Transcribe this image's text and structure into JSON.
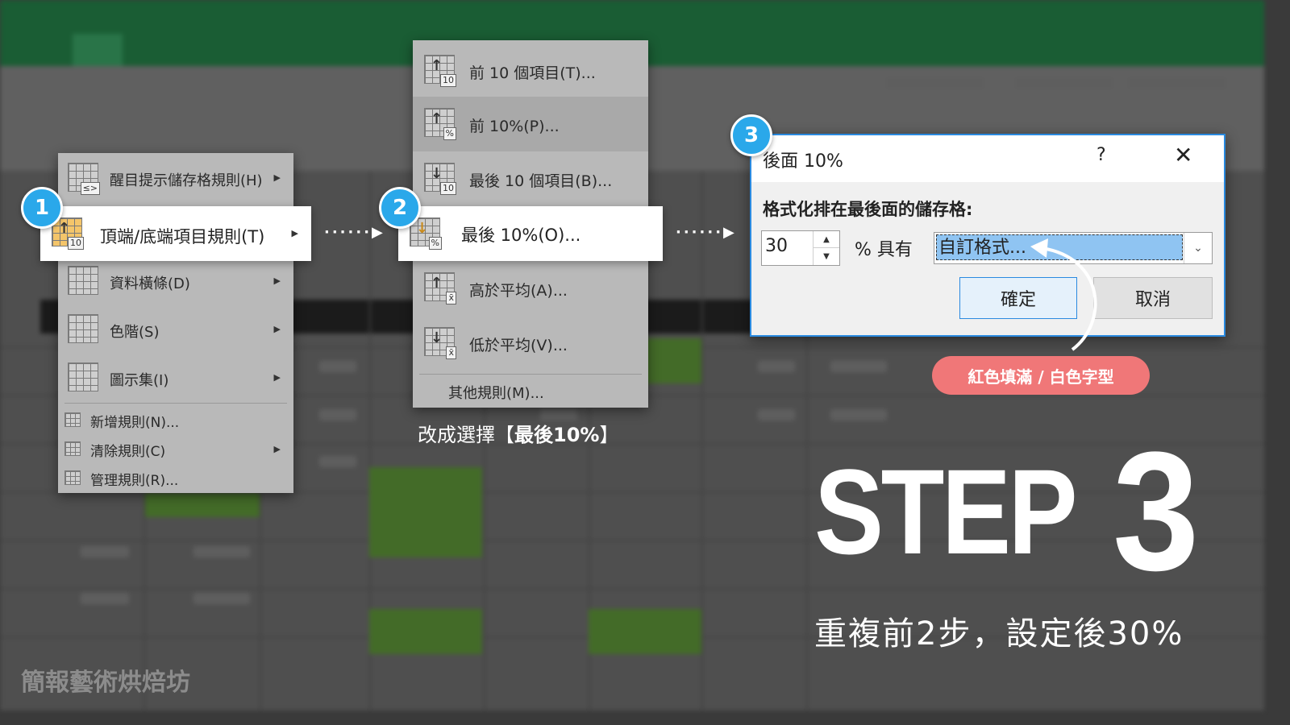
{
  "menu1": {
    "items": [
      {
        "label": "醒目提示儲存格規則(H)",
        "has_submenu": true,
        "icon": "highlight-cells-icon",
        "badge": "≤>"
      },
      {
        "label": "頂端/底端項目規則(T)",
        "has_submenu": true,
        "icon": "top-bottom-rules-icon",
        "badge": "10",
        "highlighted": true
      },
      {
        "label": "資料橫條(D)",
        "has_submenu": true,
        "icon": "data-bars-icon"
      },
      {
        "label": "色階(S)",
        "has_submenu": true,
        "icon": "color-scales-icon"
      },
      {
        "label": "圖示集(I)",
        "has_submenu": true,
        "icon": "icon-sets-icon"
      }
    ],
    "small_items": [
      {
        "label": "新增規則(N)...",
        "icon": "new-rule-icon"
      },
      {
        "label": "清除規則(C)",
        "icon": "clear-rules-icon",
        "has_submenu": true
      },
      {
        "label": "管理規則(R)...",
        "icon": "manage-rules-icon"
      }
    ]
  },
  "menu2": {
    "items": [
      {
        "label": "前 10 個項目(T)...",
        "icon": "top-10-icon",
        "badge": "10"
      },
      {
        "label": "前 10%(P)...",
        "icon": "top-10-percent-icon",
        "badge": "%"
      },
      {
        "label": "最後 10 個項目(B)...",
        "icon": "bottom-10-icon",
        "badge": "10"
      },
      {
        "label": "最後 10%(O)...",
        "icon": "bottom-10-percent-icon",
        "badge": "%",
        "highlighted": true
      },
      {
        "label": "高於平均(A)...",
        "icon": "above-average-icon",
        "badge": "x̄"
      },
      {
        "label": "低於平均(V)...",
        "icon": "below-average-icon",
        "badge": "x̄"
      }
    ],
    "more": "其他規則(M)..."
  },
  "badges": {
    "one": "1",
    "two": "2",
    "three": "3"
  },
  "dialog": {
    "title": "後面 10%",
    "help": "?",
    "close": "✕",
    "label": "格式化排在最後面的儲存格:",
    "spinner_value": "30",
    "with_text": "% 具有",
    "format_value": "自訂格式...",
    "ok": "確定",
    "cancel": "取消"
  },
  "annotation": "紅色填滿 / 白色字型",
  "caption_prefix": "改成選擇【",
  "caption_bold": "最後10%",
  "caption_suffix": "】",
  "step_word": "STEP",
  "step_number": "3",
  "subtitle": "重複前2步，設定後30%",
  "watermark": "簡報藝術烘焙坊",
  "colors": {
    "accent": "#2aa8ea",
    "pill": "#f07778",
    "excel_green": "#1e6a3c"
  }
}
